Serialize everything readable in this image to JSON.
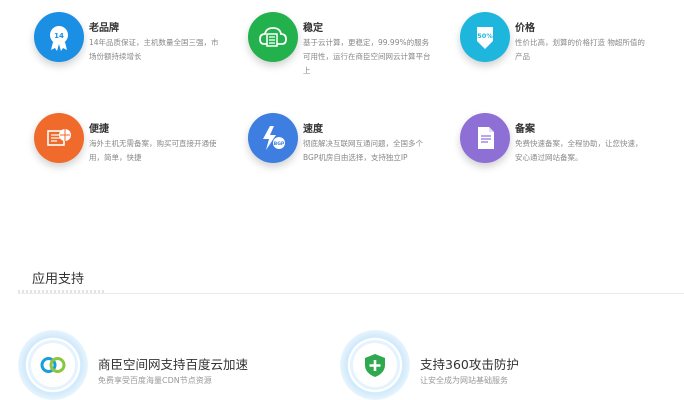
{
  "features": [
    {
      "title": "老品牌",
      "desc": "14年品质保证，主机数量全国三强，市场份额持续增长",
      "icon": "award-badge-icon",
      "color": "#1a8fe3"
    },
    {
      "title": "稳定",
      "desc": "基于云计算，更稳定，99.99%的服务可用性，运行在商臣空间网云计算平台上",
      "icon": "cloud-server-icon",
      "color": "#22b14c"
    },
    {
      "title": "价格",
      "desc": "性价比高，划算的价格打造 物超所值的产品",
      "icon": "discount-tag-icon",
      "color": "#1fb6de"
    },
    {
      "title": "便捷",
      "desc": "海外主机无需备案，购买可直接开通使用，简单，快捷",
      "icon": "globe-document-icon",
      "color": "#f06a2b"
    },
    {
      "title": "速度",
      "desc": "彻底解决互联网互通问题，全国多个BGP机房自由选择，支持独立IP",
      "icon": "bgp-speed-icon",
      "color": "#3d7ee0"
    },
    {
      "title": "备案",
      "desc": "免费快速备案，全程协助，让您快速，安心通过网站备案。",
      "icon": "document-icon",
      "color": "#8d6fd6"
    }
  ],
  "section": {
    "title": "应用支持"
  },
  "supports": [
    {
      "title": "商臣空间网支持百度云加速",
      "desc": "免费享受百度海量CDN节点资源",
      "icon": "baidu-cloud-icon"
    },
    {
      "title": "支持360攻击防护",
      "desc": "让安全成为网站基础服务",
      "icon": "shield-plus-icon"
    }
  ]
}
